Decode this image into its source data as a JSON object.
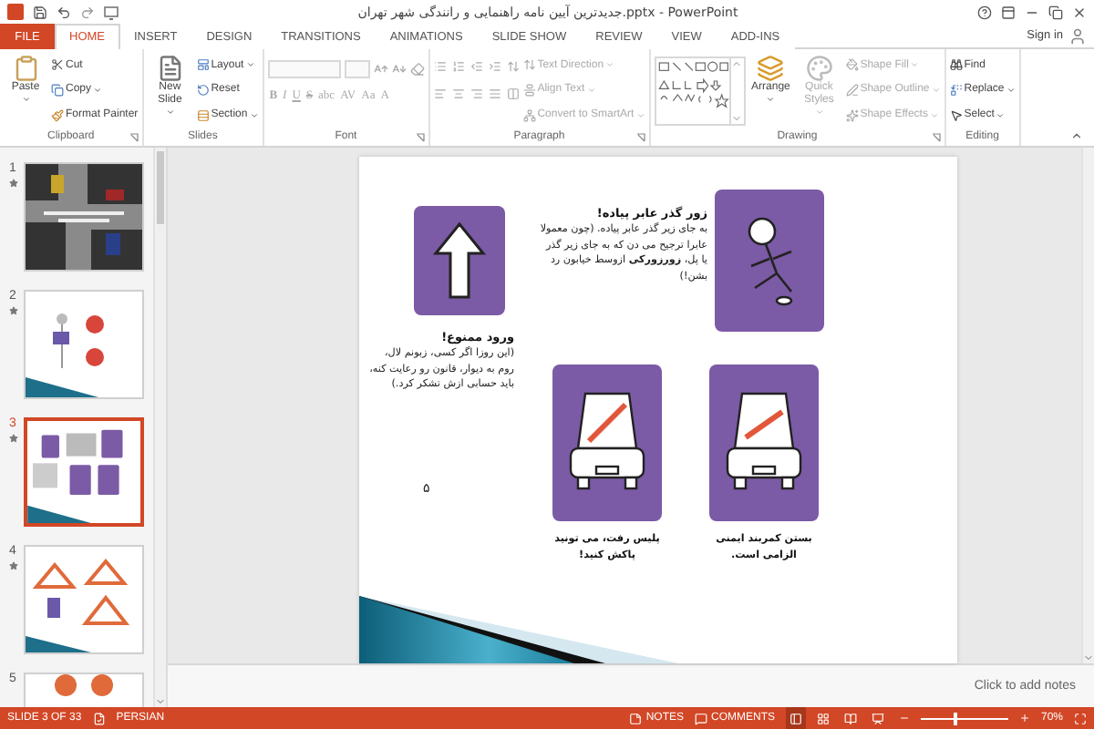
{
  "window": {
    "title": "جدیدترین آیین نامه راهنمایی و رانندگی شهر تهران.pptx - PowerPoint",
    "sign_in": "Sign in"
  },
  "tabs": [
    {
      "label": "FILE",
      "kind": "file",
      "selected": false
    },
    {
      "label": "HOME",
      "kind": "tab",
      "selected": true
    },
    {
      "label": "INSERT",
      "kind": "tab",
      "selected": false
    },
    {
      "label": "DESIGN",
      "kind": "tab",
      "selected": false
    },
    {
      "label": "TRANSITIONS",
      "kind": "tab",
      "selected": false
    },
    {
      "label": "ANIMATIONS",
      "kind": "tab",
      "selected": false
    },
    {
      "label": "SLIDE SHOW",
      "kind": "tab",
      "selected": false
    },
    {
      "label": "REVIEW",
      "kind": "tab",
      "selected": false
    },
    {
      "label": "VIEW",
      "kind": "tab",
      "selected": false
    },
    {
      "label": "ADD-INS",
      "kind": "tab",
      "selected": false
    }
  ],
  "ribbon": {
    "groups": [
      {
        "label": "Clipboard",
        "kind": "buttons",
        "launcher": true,
        "items": [
          {
            "kind": "large",
            "label": "Paste",
            "disabled": false,
            "menu": true
          },
          {
            "kind": "small",
            "label": "Cut",
            "disabled": false,
            "menu": false
          },
          {
            "kind": "small",
            "label": "Copy",
            "disabled": false,
            "menu": true
          },
          {
            "kind": "small",
            "label": "Format Painter",
            "disabled": false,
            "menu": false
          }
        ]
      },
      {
        "label": "Slides",
        "kind": "buttons",
        "launcher": false,
        "items": [
          {
            "kind": "large",
            "label": "New Slide",
            "disabled": false,
            "menu": true
          },
          {
            "kind": "small",
            "label": "Layout",
            "disabled": false,
            "menu": true
          },
          {
            "kind": "small",
            "label": "Reset",
            "disabled": false,
            "menu": false
          },
          {
            "kind": "small",
            "label": "Section",
            "disabled": false,
            "menu": true
          }
        ]
      },
      {
        "label": "Font",
        "kind": "font",
        "launcher": true,
        "glyphs": [
          "B",
          "I",
          "U",
          "S",
          "abc",
          "AV",
          "Aa",
          "A"
        ]
      },
      {
        "label": "Paragraph",
        "kind": "paragraph",
        "launcher": true,
        "items": [
          {
            "kind": "small",
            "label": "Text Direction",
            "disabled": true,
            "menu": true
          },
          {
            "kind": "small",
            "label": "Align Text",
            "disabled": true,
            "menu": true
          },
          {
            "kind": "small",
            "label": "Convert to SmartArt",
            "disabled": true,
            "menu": true
          }
        ]
      },
      {
        "label": "Drawing",
        "kind": "drawing",
        "launcher": true,
        "items": [
          {
            "kind": "large",
            "label": "Arrange",
            "disabled": false,
            "menu": true
          },
          {
            "kind": "large",
            "label": "Quick Styles",
            "disabled": true,
            "menu": true
          },
          {
            "kind": "small",
            "label": "Shape Fill",
            "disabled": true,
            "menu": true
          },
          {
            "kind": "small",
            "label": "Shape Outline",
            "disabled": true,
            "menu": true
          },
          {
            "kind": "small",
            "label": "Shape Effects",
            "disabled": true,
            "menu": true
          }
        ]
      },
      {
        "label": "Editing",
        "kind": "buttons",
        "launcher": false,
        "items": [
          {
            "kind": "small",
            "label": "Find",
            "disabled": false,
            "menu": false
          },
          {
            "kind": "small",
            "label": "Replace",
            "disabled": false,
            "menu": true
          },
          {
            "kind": "small",
            "label": "Select",
            "disabled": false,
            "menu": true
          }
        ]
      }
    ]
  },
  "slides": [
    {
      "number": "1",
      "kind": "title",
      "animated": true,
      "selected": false
    },
    {
      "number": "2",
      "kind": "diagram",
      "animated": true,
      "selected": false
    },
    {
      "number": "3",
      "kind": "cards",
      "animated": true,
      "selected": true
    },
    {
      "number": "4",
      "kind": "signs",
      "animated": true,
      "selected": false
    },
    {
      "number": "5",
      "kind": "circles",
      "animated": false,
      "selected": false
    }
  ],
  "slide": {
    "crossing": {
      "title": "زور گذر عابر پیاده!",
      "text": "به جای زیر گذر عابر پیاده. (چون معمولا عابرا ترجیح می دن که به جای زیر گذر یا پل، **زورزورکی** ازوسط خیابون رد بشن!)"
    },
    "no_entry": {
      "title": "ورود ممنوع!",
      "text": "(این روزا اگر کسی، زبونم لال، روم به دیوار، قانون رو رعایت کنه، باید حسابی ازش تشکر کرد.)"
    },
    "captions": [
      "بستن کمربند ایمنی الزامی است.",
      "پلیس رفت، می تونید پاکش کنید!"
    ],
    "page_number": "۵"
  },
  "notes": {
    "placeholder": "Click to add notes"
  },
  "status_bar": {
    "slide": "SLIDE 3 OF 33",
    "language": "PERSIAN",
    "notes": "NOTES",
    "comments": "COMMENTS",
    "views": [
      {
        "selected": true
      },
      {
        "selected": false
      },
      {
        "selected": false
      },
      {
        "selected": false
      }
    ],
    "zoom": {
      "level": 0.4,
      "reading": "70%"
    }
  }
}
